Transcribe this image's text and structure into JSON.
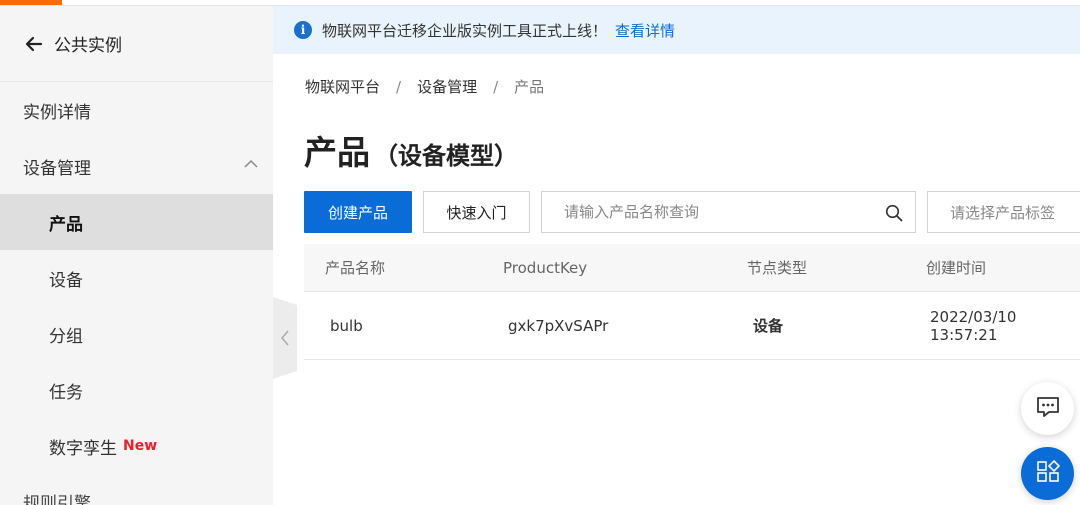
{
  "notice": {
    "text": "物联网平台迁移企业版实例工具正式上线！",
    "link": "查看详情"
  },
  "sidebar": {
    "back_label": "公共实例",
    "items": [
      {
        "label": "实例详情"
      },
      {
        "label": "设备管理"
      },
      {
        "label": "产品"
      },
      {
        "label": "设备"
      },
      {
        "label": "分组"
      },
      {
        "label": "任务"
      },
      {
        "label": "数字孪生",
        "badge": "New"
      },
      {
        "label": "规则引擎"
      }
    ]
  },
  "breadcrumb": [
    "物联网平台",
    "设备管理",
    "产品"
  ],
  "breadcrumb_sep": "/",
  "page": {
    "title": "产品",
    "subtitle": "（设备模型）"
  },
  "toolbar": {
    "create_label": "创建产品",
    "quickstart_label": "快速入门",
    "search_placeholder": "请输入产品名称查询",
    "tag_placeholder": "请选择产品标签"
  },
  "table": {
    "columns": [
      "产品名称",
      "ProductKey",
      "节点类型",
      "创建时间"
    ],
    "rows": [
      [
        "bulb",
        "gxk7pXvSAPr",
        "设备",
        "2022/03/10 13:57:21"
      ]
    ]
  },
  "colors": {
    "primary": "#0a6cd6",
    "accent": "#ff6a00",
    "badge": "#e8212c"
  }
}
